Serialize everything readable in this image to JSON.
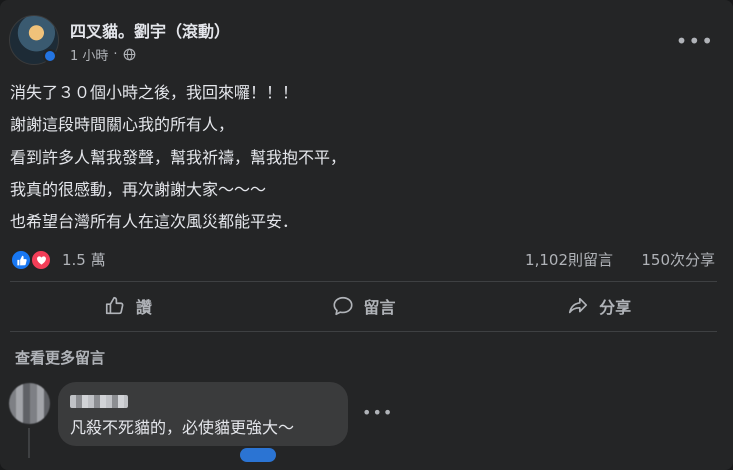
{
  "post": {
    "author": "四叉貓。劉宇（滾動）",
    "time": "1 小時",
    "time_separator": "·",
    "privacy_icon": "globe-icon",
    "more_icon": "more-horizontal-icon",
    "lines": [
      "消失了３０個小時之後，我回來囉！！！",
      "謝謝這段時間關心我的所有人，",
      "看到許多人幫我發聲，幫我祈禱，幫我抱不平，",
      "我真的很感動，再次謝謝大家～～～",
      "也希望台灣所有人在這次風災都能平安．"
    ]
  },
  "stats": {
    "reactions": "1.5 萬",
    "reaction_icons": [
      "like-icon",
      "love-icon"
    ],
    "comments": "1,102則留言",
    "shares": "150次分享"
  },
  "actions": {
    "like": "讚",
    "comment": "留言",
    "share": "分享"
  },
  "comments": {
    "view_more": "查看更多留言",
    "items": [
      {
        "text": "凡殺不死貓的，必使貓更強大～"
      }
    ],
    "more_icon": "more-horizontal-icon"
  },
  "colors": {
    "background": "#242526",
    "text_primary": "#e4e6eb",
    "text_secondary": "#b0b3b8",
    "like_blue": "#1877f2",
    "love_red": "#f33e58",
    "bubble": "#3a3b3c"
  }
}
